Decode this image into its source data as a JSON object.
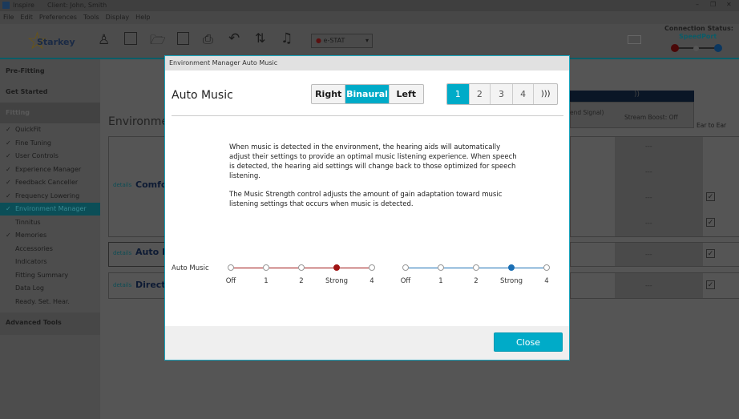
{
  "app": {
    "name": "Inspire",
    "client": "Client: John, Smith"
  },
  "menu": [
    "File",
    "Edit",
    "Preferences",
    "Tools",
    "Display",
    "Help"
  ],
  "brand": "Starkey",
  "device_select": "e-STAT",
  "connection": {
    "label": "Connection Status:",
    "value": "SpeedPort"
  },
  "sidebar": {
    "pre_fitting": "Pre-Fitting",
    "get_started": "Get Started",
    "fitting": "Fitting",
    "items": [
      {
        "label": "QuickFit",
        "checked": true
      },
      {
        "label": "Fine Tuning",
        "checked": true
      },
      {
        "label": "User Controls",
        "checked": true
      },
      {
        "label": "Experience Manager",
        "checked": true
      },
      {
        "label": "Feedback Canceller",
        "checked": true
      },
      {
        "label": "Frequency Lowering",
        "checked": true
      },
      {
        "label": "Environment Manager",
        "checked": true,
        "active": true
      },
      {
        "label": "Tinnitus",
        "checked": false
      },
      {
        "label": "Memories",
        "checked": true
      },
      {
        "label": "Accessories",
        "checked": false
      },
      {
        "label": "Indicators",
        "checked": false
      },
      {
        "label": "Fitting Summary",
        "checked": false
      },
      {
        "label": "Data Log",
        "checked": false
      },
      {
        "label": "Ready. Set. Hear.",
        "checked": false
      }
    ],
    "advanced": "Advanced Tools"
  },
  "background": {
    "title": "Environme",
    "details": "details",
    "rows": [
      "Comfo",
      "Auto M",
      "Directi"
    ],
    "col_header_partial": "end Signal)",
    "stream_boost": "Stream Boost: Off",
    "ear_to_ear": "Ear to Ear",
    "dash": "---"
  },
  "modal": {
    "window_title": "Environment Manager Auto Music",
    "heading": "Auto Music",
    "sides": [
      "Right",
      "Binaural",
      "Left"
    ],
    "side_selected": "Binaural",
    "memories": [
      "1",
      "2",
      "3",
      "4"
    ],
    "memory_selected": "1",
    "para1": "When music is detected in the environment, the hearing aids will automatically adjust their settings to provide an optimal music listening experience.  When speech is detected, the hearing aid settings will change back to those optimized for speech listening.",
    "para2": "The Music Strength control adjusts the amount of gain adaptation toward music listening settings that occurs when music is detected.",
    "control_label": "Auto Music",
    "levels": [
      "Off",
      "1",
      "2",
      "Strong",
      "4"
    ],
    "right_value": "Strong",
    "left_value": "Strong",
    "colors": {
      "right": "#a01515",
      "left": "#1a6fb5",
      "accent": "#00abc8"
    },
    "close": "Close"
  }
}
